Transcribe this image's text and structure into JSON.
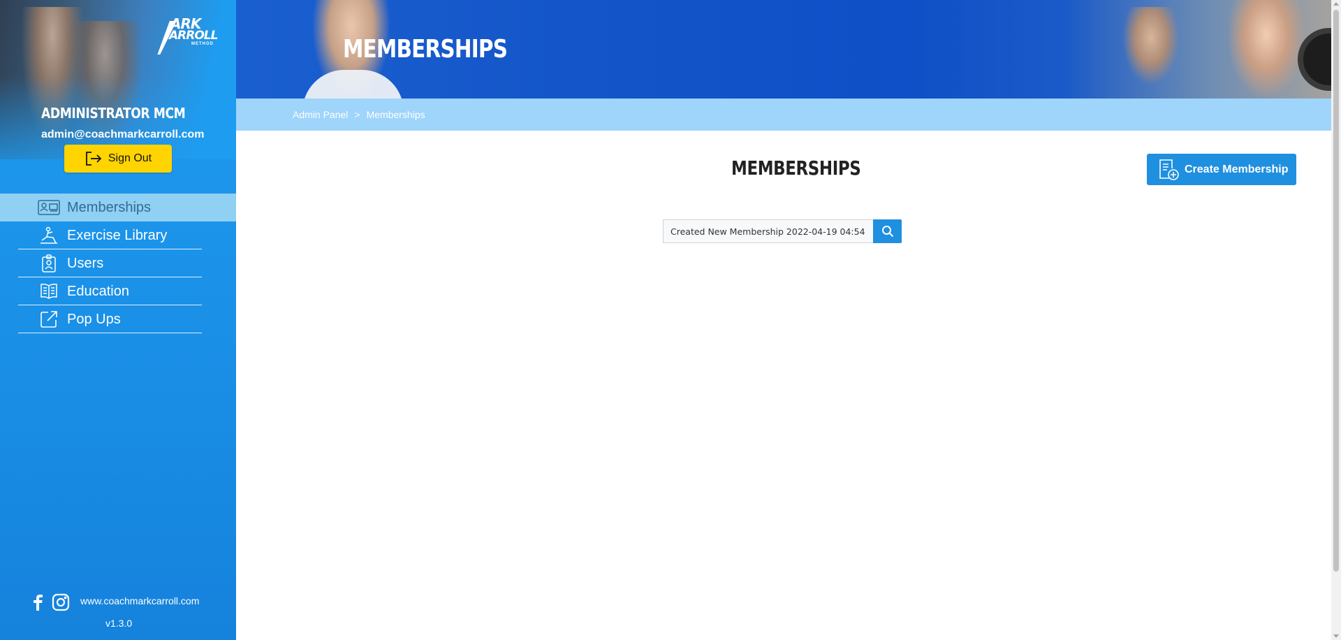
{
  "brand": {
    "logo_line1": "ARK",
    "logo_line2": "ARROLL",
    "logo_sub": "METHOD"
  },
  "user": {
    "name": "Administrator MCM",
    "email": "admin@coachmarkcarroll.com",
    "sign_out_label": "Sign Out"
  },
  "sidebar": {
    "items": [
      {
        "label": "Memberships",
        "icon": "membership-card-icon",
        "active": true
      },
      {
        "label": "Exercise Library",
        "icon": "exercise-icon",
        "active": false
      },
      {
        "label": "Users",
        "icon": "user-badge-icon",
        "active": false
      },
      {
        "label": "Education",
        "icon": "book-icon",
        "active": false
      },
      {
        "label": "Pop Ups",
        "icon": "external-link-icon",
        "active": false
      }
    ],
    "footer": {
      "website": "www.coachmarkcarroll.com",
      "version": "v1.3.0",
      "social": [
        "facebook-icon",
        "instagram-icon"
      ]
    }
  },
  "header": {
    "title": "MEMBERSHIPS"
  },
  "breadcrumb": {
    "root": "Admin Panel",
    "separator": ">",
    "current": "Memberships"
  },
  "main": {
    "title": "MEMBERSHIPS",
    "create_button_label": "Create Membership",
    "search": {
      "value": "Created New Membership 2022-04-19 04:54",
      "icon": "search-icon"
    }
  },
  "colors": {
    "sidebar": "#1e9cf0",
    "active_item": "#8fd0f3",
    "accent": "#1f8fe0",
    "sign_out": "#ffd400",
    "breadcrumb_bar": "#9fd4fb"
  }
}
